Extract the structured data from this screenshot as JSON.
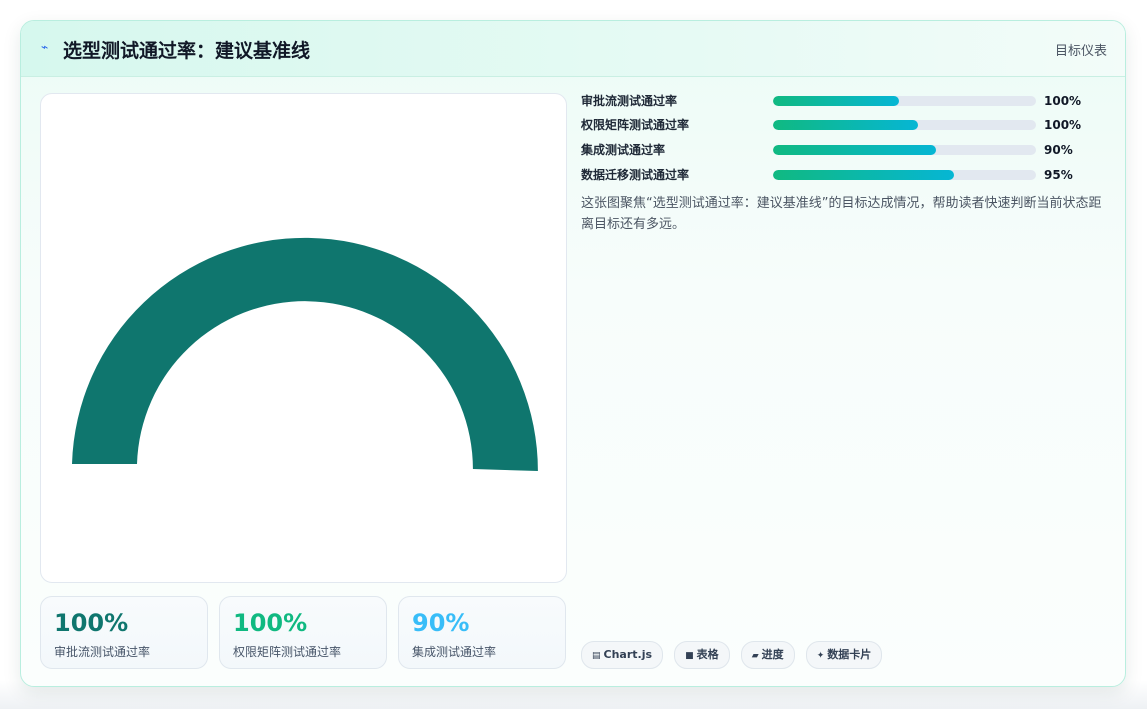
{
  "header": {
    "icon": "lightning-icon",
    "title": "选型测试通过率：建议基准线",
    "right_label": "目标仪表"
  },
  "colors": {
    "gauge_fill": "#0f766e",
    "stat_colors": [
      "#0f766e",
      "#10b981",
      "#38bdf8"
    ],
    "bar_gradient_start": "#10b981",
    "bar_gradient_end": "#06b6d4",
    "bar_track": "#e2e8f0"
  },
  "chart_data": {
    "type": "gauge",
    "value_fraction": 1.0,
    "title": "",
    "series": []
  },
  "bars": [
    {
      "label": "审批流测试通过率",
      "percent_text": "100%",
      "fill_fraction": 0.48
    },
    {
      "label": "权限矩阵测试通过率",
      "percent_text": "100%",
      "fill_fraction": 0.55
    },
    {
      "label": "集成测试通过率",
      "percent_text": "90%",
      "fill_fraction": 0.62
    },
    {
      "label": "数据迁移测试通过率",
      "percent_text": "95%",
      "fill_fraction": 0.69
    }
  ],
  "description": "这张图聚焦“选型测试通过率：建议基准线”的目标达成情况，帮助读者快速判断当前状态距离目标还有多远。",
  "stats": [
    {
      "value": "100%",
      "label": "审批流测试通过率"
    },
    {
      "value": "100%",
      "label": "权限矩阵测试通过率"
    },
    {
      "value": "90%",
      "label": "集成测试通过率"
    }
  ],
  "tags": [
    {
      "icon": "chart-icon",
      "glyph": "▤",
      "label": "Chart.js"
    },
    {
      "icon": "table-icon",
      "glyph": "■",
      "label": "表格"
    },
    {
      "icon": "progress-icon",
      "glyph": "▰",
      "label": "进度"
    },
    {
      "icon": "sparkle-icon",
      "glyph": "✦",
      "label": "数据卡片"
    }
  ]
}
